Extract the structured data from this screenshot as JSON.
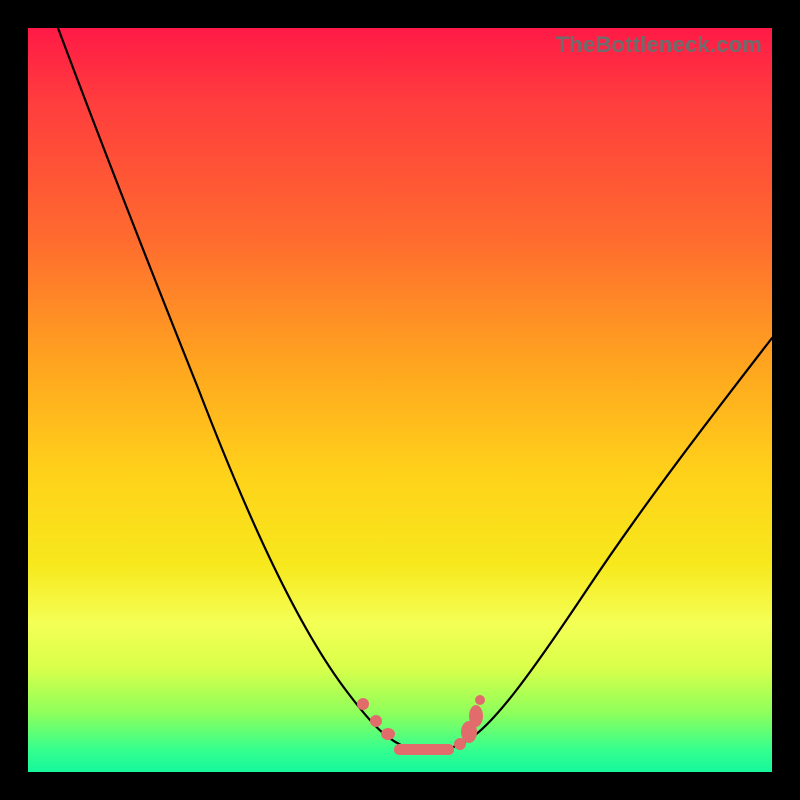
{
  "watermark": "TheBottleneck.com",
  "colors": {
    "frame": "#000000",
    "marker": "#e26c6c",
    "curve": "#000000",
    "gradient_top": "#ff1a46",
    "gradient_bottom": "#16f79c"
  },
  "chart_data": {
    "type": "line",
    "title": "",
    "xlabel": "",
    "ylabel": "",
    "xlim": [
      0,
      100
    ],
    "ylim": [
      0,
      100
    ],
    "curve": {
      "x": [
        4,
        8,
        12,
        16,
        20,
        24,
        28,
        32,
        36,
        40,
        44,
        47,
        50,
        53,
        56,
        60,
        64,
        70,
        76,
        82,
        88,
        94,
        100
      ],
      "y": [
        100,
        92,
        83,
        75,
        67,
        58,
        50,
        41,
        33,
        24,
        15,
        9,
        5,
        3,
        3,
        5,
        10,
        18,
        26,
        34,
        42,
        50,
        58
      ]
    },
    "markers": {
      "x": [
        45,
        47,
        48,
        50,
        52,
        54,
        56,
        57,
        58,
        59,
        60
      ],
      "y": [
        10,
        7,
        5,
        3.5,
        3,
        3,
        3.5,
        4.5,
        6,
        8,
        10
      ]
    }
  }
}
